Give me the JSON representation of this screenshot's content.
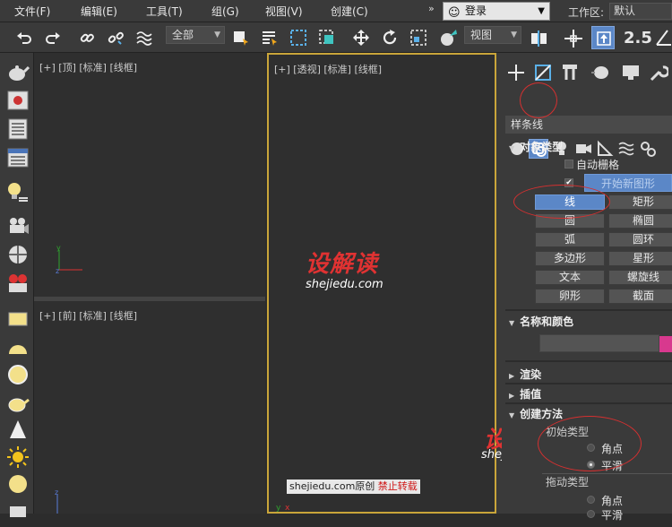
{
  "menubar": {
    "items": [
      "文件(F)",
      "编辑(E)",
      "工具(T)",
      "组(G)",
      "视图(V)",
      "创建(C)"
    ],
    "expand": "»",
    "login": "登录",
    "workspace_label": "工作区:",
    "workspace_value": "默认"
  },
  "toolbar": {
    "selection_filter": "全部",
    "ref_coord": "视图",
    "snap_label": "2.5"
  },
  "viewports": {
    "top": "[+] [顶] [标准] [线框]",
    "perspective": "[+] [透视] [标准] [线框]",
    "front": "[+] [前] [标准] [线框]"
  },
  "watermark": {
    "brand": "设解读",
    "url": "shejiedu.com",
    "tag_site": "shejiedu.com原创",
    "tag_warn": "禁止转载"
  },
  "command_panel": {
    "category": "样条线",
    "object_type": {
      "title": "对象类型",
      "autogrid": "自动栅格",
      "start_new_shape": "开始新图形",
      "start_new_shape_checked": true,
      "buttons": [
        "线",
        "矩形",
        "圆",
        "椭圆",
        "弧",
        "圆环",
        "多边形",
        "星形",
        "文本",
        "螺旋线",
        "卵形",
        "截面"
      ],
      "active_button": "线"
    },
    "name_color": {
      "title": "名称和颜色",
      "color": "#d8398e"
    },
    "rendering": "渲染",
    "interpolation": "插值",
    "creation_method": {
      "title": "创建方法",
      "initial_type_label": "初始类型",
      "initial_options": [
        "角点",
        "平滑"
      ],
      "initial_selected": "平滑",
      "drag_type_label": "拖动类型",
      "drag_options": [
        "角点",
        "平滑"
      ]
    }
  }
}
